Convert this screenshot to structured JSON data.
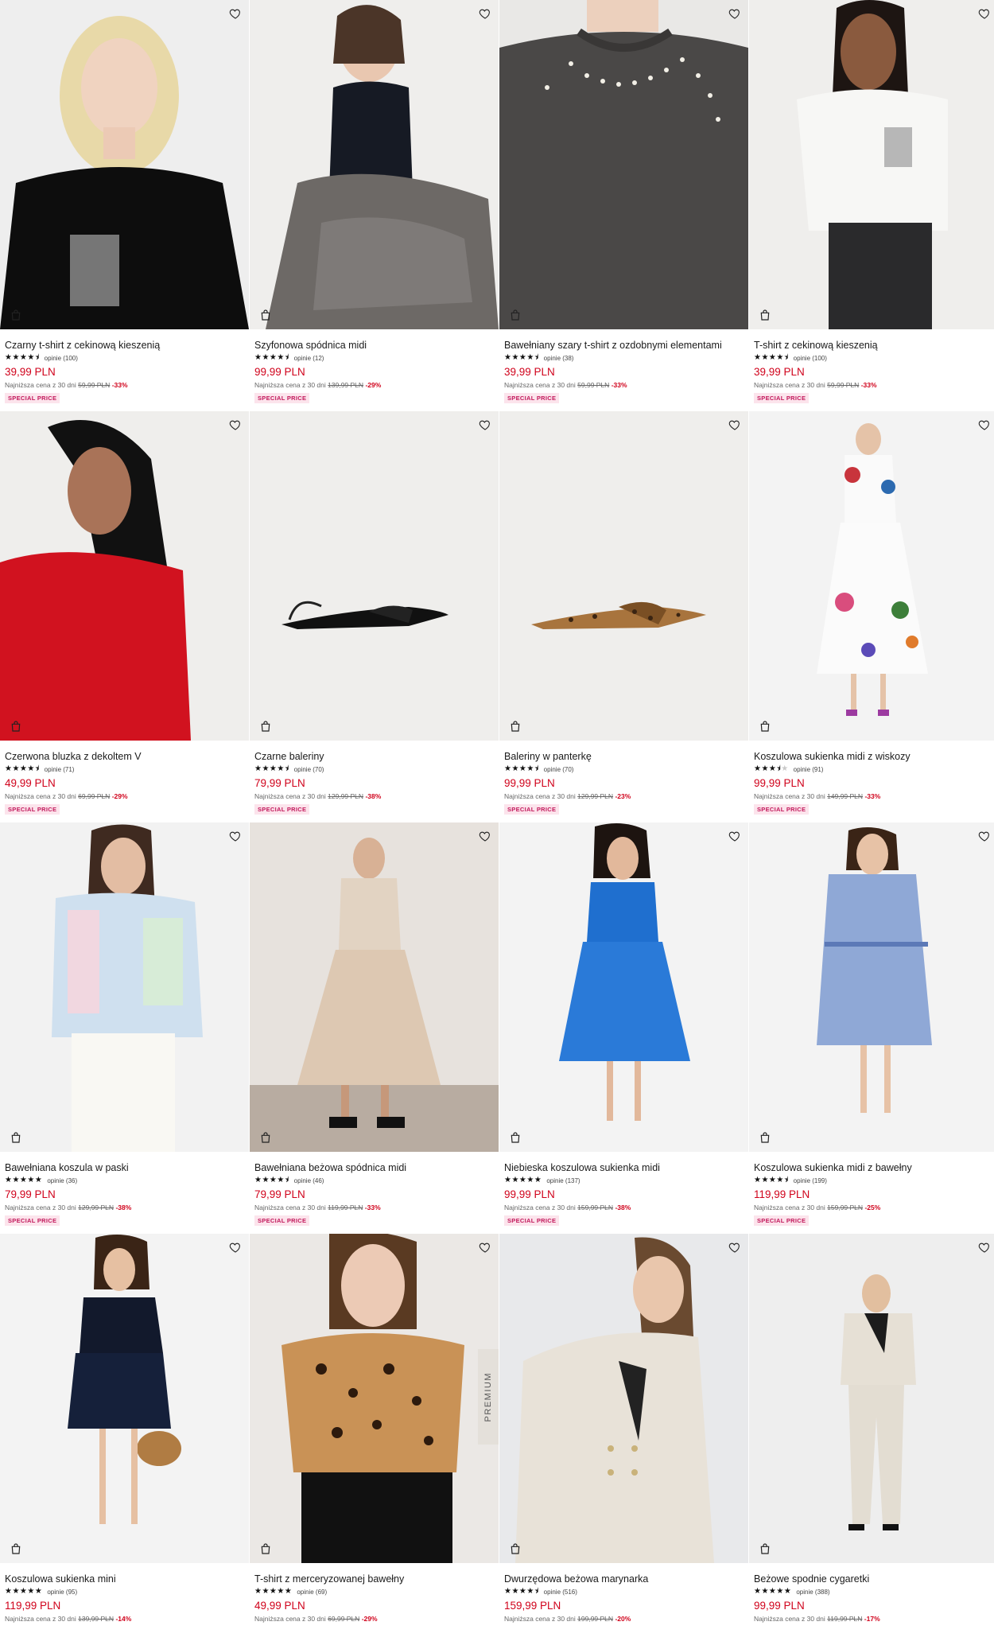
{
  "products": [
    {
      "name": "Czarny t-shirt z cekinową kieszenią",
      "stars": 4.5,
      "reviews": "opinie (100)",
      "price": "39,99 PLN",
      "lowest_prefix": "Najniższa cena z 30 dni",
      "old_price": "59,99 PLN",
      "discount": "-33%",
      "badge": "SPECIAL PRICE",
      "icon": "heart-icon"
    },
    {
      "name": "Szyfonowa spódnica midi",
      "stars": 4.5,
      "reviews": "opinie (12)",
      "price": "99,99 PLN",
      "lowest_prefix": "Najniższa cena z 30 dni",
      "old_price": "139,99 PLN",
      "discount": "-29%",
      "badge": "SPECIAL PRICE"
    },
    {
      "name": "Bawełniany szary t-shirt z ozdobnymi elementami",
      "stars": 4.5,
      "reviews": "opinie (38)",
      "price": "39,99 PLN",
      "lowest_prefix": "Najniższa cena z 30 dni",
      "old_price": "59,99 PLN",
      "discount": "-33%",
      "badge": "SPECIAL PRICE"
    },
    {
      "name": "T-shirt z cekinową kieszenią",
      "stars": 4.5,
      "reviews": "opinie (100)",
      "price": "39,99 PLN",
      "lowest_prefix": "Najniższa cena z 30 dni",
      "old_price": "59,99 PLN",
      "discount": "-33%",
      "badge": "SPECIAL PRICE"
    },
    {
      "name": "Czerwona bluzka z dekoltem V",
      "stars": 4.5,
      "reviews": "opinie (71)",
      "price": "49,99 PLN",
      "lowest_prefix": "Najniższa cena z 30 dni",
      "old_price": "69,99 PLN",
      "discount": "-29%",
      "badge": "SPECIAL PRICE"
    },
    {
      "name": "Czarne baleriny",
      "stars": 4.5,
      "reviews": "opinie (70)",
      "price": "79,99 PLN",
      "lowest_prefix": "Najniższa cena z 30 dni",
      "old_price": "129,99 PLN",
      "discount": "-38%",
      "badge": "SPECIAL PRICE"
    },
    {
      "name": "Baleriny w panterkę",
      "stars": 4.5,
      "reviews": "opinie (70)",
      "price": "99,99 PLN",
      "lowest_prefix": "Najniższa cena z 30 dni",
      "old_price": "129,99 PLN",
      "discount": "-23%",
      "badge": "SPECIAL PRICE"
    },
    {
      "name": "Koszulowa sukienka midi z wiskozy",
      "stars": 3.5,
      "reviews": "opinie (91)",
      "price": "99,99 PLN",
      "lowest_prefix": "Najniższa cena z 30 dni",
      "old_price": "149,99 PLN",
      "discount": "-33%",
      "badge": "SPECIAL PRICE"
    },
    {
      "name": "Bawełniana koszula w paski",
      "stars": 5,
      "reviews": "opinie (36)",
      "price": "79,99 PLN",
      "lowest_prefix": "Najniższa cena z 30 dni",
      "old_price": "129,99 PLN",
      "discount": "-38%",
      "badge": "SPECIAL PRICE"
    },
    {
      "name": "Bawełniana beżowa spódnica midi",
      "stars": 4.5,
      "reviews": "opinie (46)",
      "price": "79,99 PLN",
      "lowest_prefix": "Najniższa cena z 30 dni",
      "old_price": "119,99 PLN",
      "discount": "-33%",
      "badge": "SPECIAL PRICE"
    },
    {
      "name": "Niebieska koszulowa sukienka midi",
      "stars": 5,
      "reviews": "opinie (137)",
      "price": "99,99 PLN",
      "lowest_prefix": "Najniższa cena z 30 dni",
      "old_price": "159,99 PLN",
      "discount": "-38%",
      "badge": "SPECIAL PRICE"
    },
    {
      "name": "Koszulowa sukienka midi z bawełny",
      "stars": 4.5,
      "reviews": "opinie (199)",
      "price": "119,99 PLN",
      "lowest_prefix": "Najniższa cena z 30 dni",
      "old_price": "159,99 PLN",
      "discount": "-25%",
      "badge": "SPECIAL PRICE"
    },
    {
      "name": "Koszulowa sukienka mini",
      "stars": 5,
      "reviews": "opinie (95)",
      "price": "119,99 PLN",
      "lowest_prefix": "Najniższa cena z 30 dni",
      "old_price": "139,99 PLN",
      "discount": "-14%",
      "badge": ""
    },
    {
      "name": "T-shirt z merceryzowanej bawełny",
      "stars": 5,
      "reviews": "opinie (69)",
      "price": "49,99 PLN",
      "lowest_prefix": "Najniższa cena z 30 dni",
      "old_price": "69,99 PLN",
      "discount": "-29%",
      "badge": "",
      "tag": "PREMIUM"
    },
    {
      "name": "Dwurzędowa beżowa marynarka",
      "stars": 4.5,
      "reviews": "opinie (516)",
      "price": "159,99 PLN",
      "lowest_prefix": "Najniższa cena z 30 dni",
      "old_price": "199,99 PLN",
      "discount": "-20%",
      "badge": ""
    },
    {
      "name": "Beżowe spodnie cygaretki",
      "stars": 5,
      "reviews": "opinie (388)",
      "price": "99,99 PLN",
      "lowest_prefix": "Najniższa cena z 30 dni",
      "old_price": "119,99 PLN",
      "discount": "-17%",
      "badge": ""
    }
  ],
  "colors": {
    "price": "#d0021b",
    "badge_text": "#c2185b",
    "badge_bg": "#fce4ec"
  }
}
